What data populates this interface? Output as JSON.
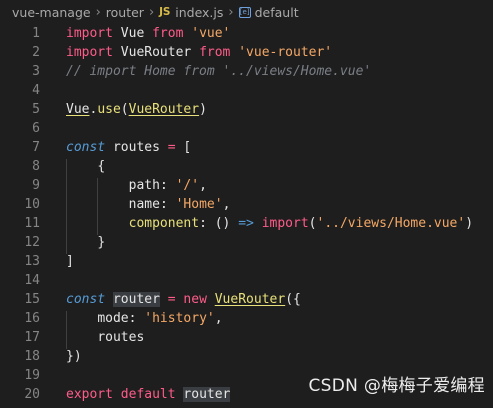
{
  "breadcrumb": {
    "folder": "vue-manage",
    "subfolder": "router",
    "file_icon": "JS",
    "file": "index.js",
    "symbol_icon": "[e]",
    "symbol": "default"
  },
  "lines": {
    "n1": "1",
    "n2": "2",
    "n3": "3",
    "n4": "4",
    "n5": "5",
    "n6": "6",
    "n7": "7",
    "n8": "8",
    "n9": "9",
    "n10": "10",
    "n11": "11",
    "n12": "12",
    "n13": "13",
    "n14": "14",
    "n15": "15",
    "n16": "16",
    "n17": "17",
    "n18": "18",
    "n19": "19",
    "n20": "20"
  },
  "code": {
    "import": "import",
    "from": "from",
    "vue": "Vue",
    "str_vue": "'vue'",
    "vuerouter": "VueRouter",
    "str_vue_router": "'vue-router'",
    "comment": "// import Home from '../views/Home.vue'",
    "vue_use": "Vue",
    "dot_use": ".",
    "use": "use",
    "paren_open": "(",
    "paren_close": ")",
    "const": "const",
    "routes": "routes",
    "eq": "=",
    "bracket_open": "[",
    "brace_open": "{",
    "path_key": "path",
    "colon": ":",
    "str_slash": "'/'",
    "comma": ",",
    "name_key": "name",
    "str_home": "'Home'",
    "component_key": "component",
    "arrow_parens": "()",
    "arrow": "=>",
    "import_call": "import",
    "str_home_vue": "'../views/Home.vue'",
    "brace_close": "}",
    "bracket_close": "]",
    "router": "router",
    "new": "new",
    "new_paren_brace": "({",
    "mode_key": "mode",
    "str_history": "'history'",
    "routes_short": "routes",
    "close_paren_brace": "})",
    "export": "export",
    "default": "default",
    "router_export": "router"
  },
  "watermark": "CSDN @梅梅子爱编程"
}
